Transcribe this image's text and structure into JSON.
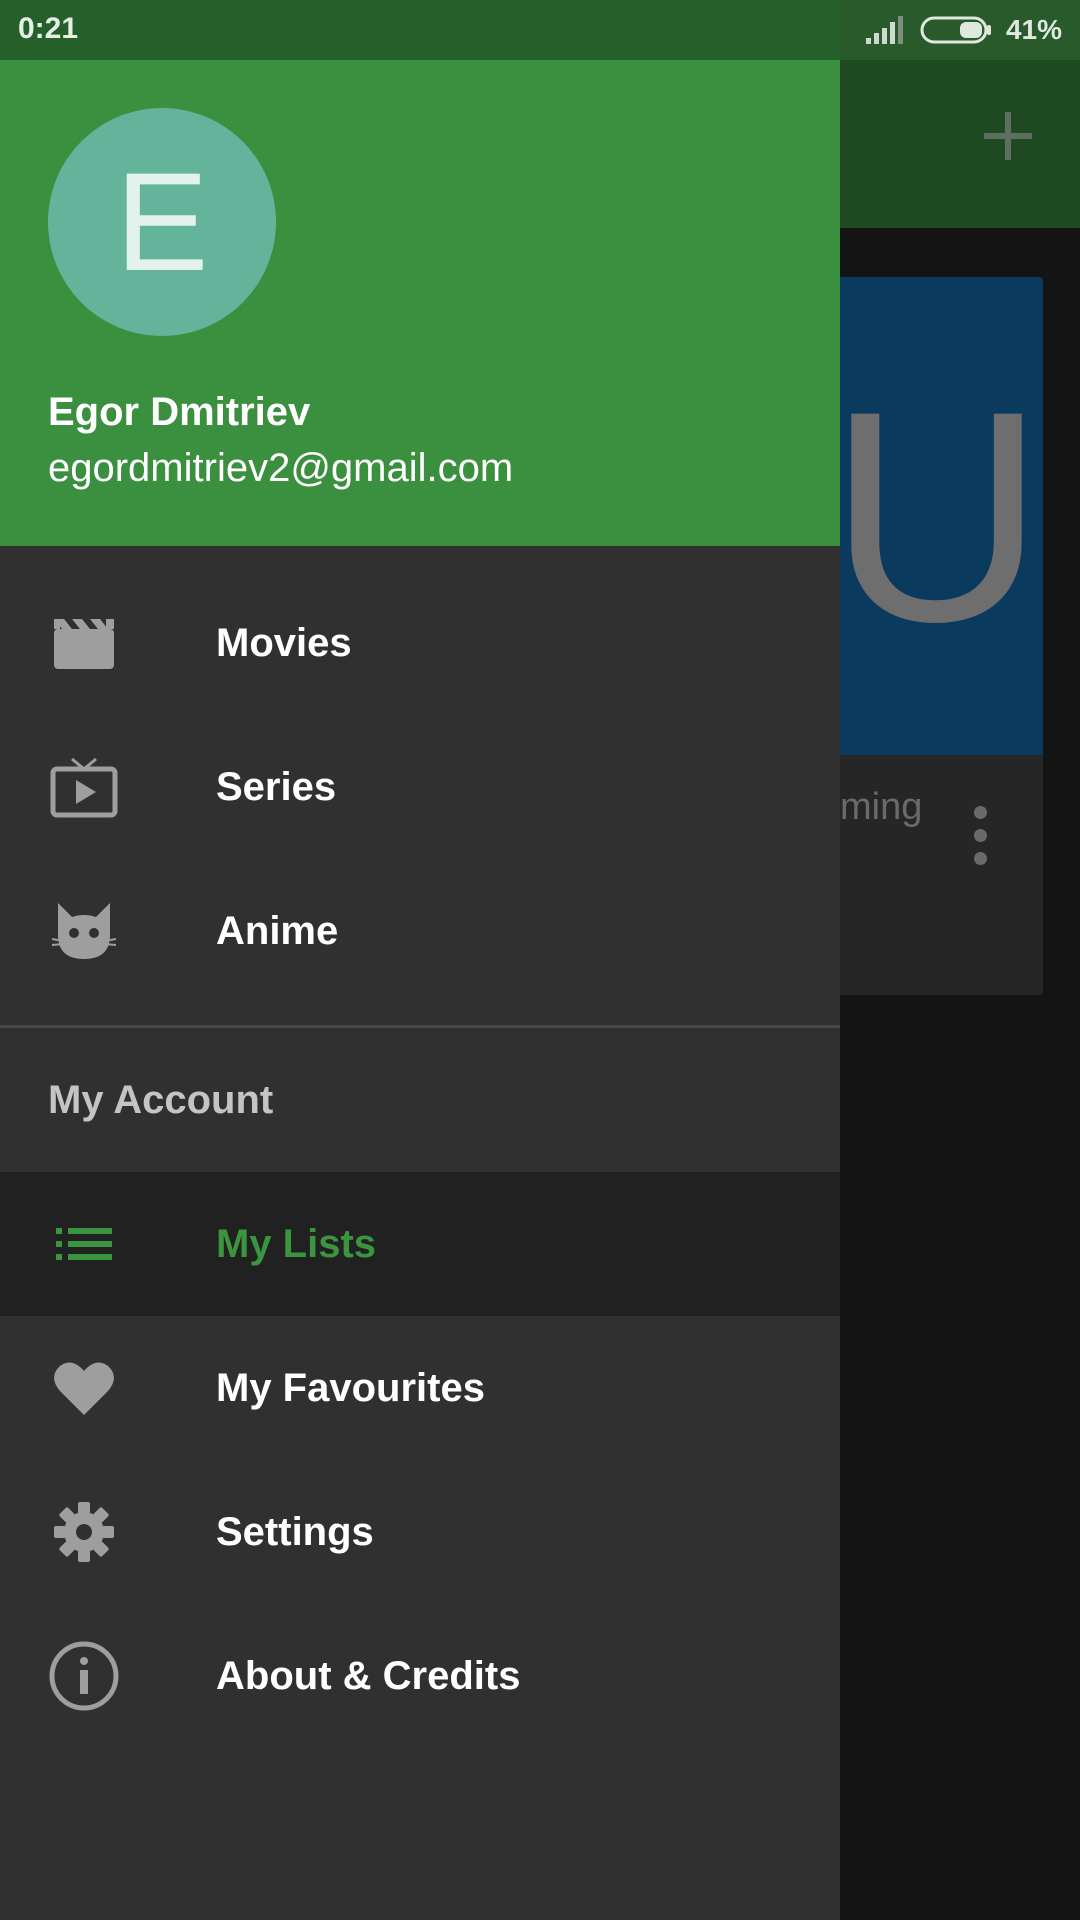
{
  "status_bar": {
    "time": "0:21",
    "battery_percent": "41%"
  },
  "background_app": {
    "card_letter": "U",
    "card_title_fragment": "ming"
  },
  "drawer": {
    "avatar_letter": "E",
    "user_name": "Egor Dmitriev",
    "user_email": "egordmitriev2@gmail.com",
    "primary_items": [
      {
        "label": "Movies",
        "icon": "movie-clapper-icon"
      },
      {
        "label": "Series",
        "icon": "tv-play-icon"
      },
      {
        "label": "Anime",
        "icon": "cat-face-icon"
      }
    ],
    "section_title": "My Account",
    "account_items": [
      {
        "label": "My Lists",
        "icon": "list-icon",
        "selected": true
      },
      {
        "label": "My Favourites",
        "icon": "heart-icon"
      },
      {
        "label": "Settings",
        "icon": "gear-icon"
      },
      {
        "label": "About & Credits",
        "icon": "info-icon"
      }
    ]
  },
  "colors": {
    "primary_green": "#3a903e",
    "status_bar_green": "#255f2a",
    "drawer_background": "#303030",
    "selected_item_background": "#212121",
    "avatar_color": "#63b49b"
  }
}
